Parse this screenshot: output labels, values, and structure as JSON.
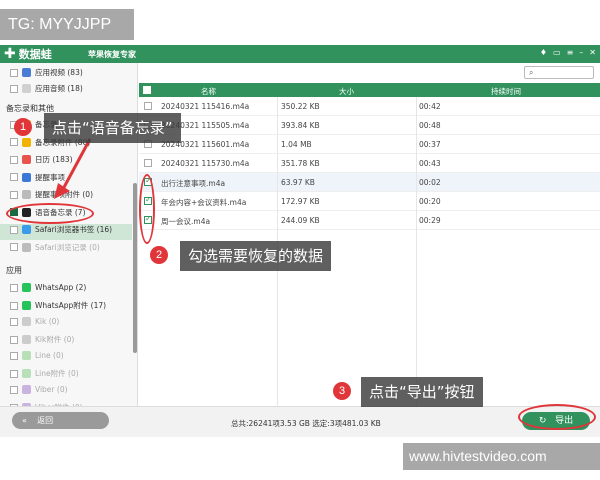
{
  "tag": "TG: MYYJJPP",
  "watermark": "www.hivtestvideo.com",
  "titlebar": {
    "brand": "数据蛙",
    "subtitle": "苹果恢复专家"
  },
  "sidebar": {
    "items_top": [
      {
        "label": "应用视频 (83)",
        "icon_color": "#4a7cd6"
      },
      {
        "label": "应用音频 (18)",
        "icon_color": "#d0d0d0"
      }
    ],
    "section_memo": "备忘录和其他",
    "items_memo": [
      {
        "label": "备忘录",
        "icon_color": "#f0b400"
      },
      {
        "label": "备忘录附件 (80)",
        "icon_color": "#f0b400"
      },
      {
        "label": "日历 (183)",
        "icon_color": "#e8534e"
      },
      {
        "label": "提醒事项",
        "icon_color": "#3a78d8"
      },
      {
        "label": "提醒事项附件 (0)",
        "icon_color": "#bbbbbb"
      },
      {
        "label": "语音备忘录 (7)",
        "icon_color": "#222222"
      },
      {
        "label": "Safari浏览器书签 (16)",
        "icon_color": "#3a9be8"
      },
      {
        "label": "Safari浏览记录 (0)",
        "icon_color": "#bbbbbb"
      }
    ],
    "section_apps": "应用",
    "items_apps": [
      {
        "label": "WhatsApp (2)",
        "icon_color": "#25c35a"
      },
      {
        "label": "WhatsApp附件 (17)",
        "icon_color": "#25c35a"
      },
      {
        "label": "Kik (0)",
        "icon_color": "#cccccc"
      },
      {
        "label": "Kik附件 (0)",
        "icon_color": "#cccccc"
      },
      {
        "label": "Line (0)",
        "icon_color": "#b8e0b8"
      },
      {
        "label": "Line附件 (0)",
        "icon_color": "#b8e0b8"
      },
      {
        "label": "Viber (0)",
        "icon_color": "#c9b4e0"
      },
      {
        "label": "Viber附件 (0)",
        "icon_color": "#c9b4e0"
      }
    ]
  },
  "table": {
    "headers": [
      "名称",
      "大小",
      "持续时间"
    ],
    "rows": [
      {
        "name": "20240321 115416.m4a",
        "size": "350.22 KB",
        "duration": "00:42",
        "checked": false
      },
      {
        "name": "20240321 115505.m4a",
        "size": "393.84 KB",
        "duration": "00:48",
        "checked": false
      },
      {
        "name": "20240321 115601.m4a",
        "size": "1.04 MB",
        "duration": "00:37",
        "checked": false
      },
      {
        "name": "20240321 115730.m4a",
        "size": "351.78 KB",
        "duration": "00:43",
        "checked": false
      },
      {
        "name": "出行注意事项.m4a",
        "size": "63.97 KB",
        "duration": "00:02",
        "checked": true
      },
      {
        "name": "年会内容+会议资料.m4a",
        "size": "172.97 KB",
        "duration": "00:20",
        "checked": true
      },
      {
        "name": "周一会议.m4a",
        "size": "244.09 KB",
        "duration": "00:29",
        "checked": true
      }
    ]
  },
  "footer": {
    "back_label": "返回",
    "status": "总共:26241项3.53 GB 选定:3项481.03 KB",
    "export_label": "导出"
  },
  "annotations": [
    {
      "num": "1",
      "text": "点击“语音备忘录”"
    },
    {
      "num": "2",
      "text": "勾选需要恢复的数据"
    },
    {
      "num": "3",
      "text": "点击“导出”按钮"
    }
  ],
  "colors": {
    "accent": "#31925e",
    "annotation": "#e0363a"
  }
}
